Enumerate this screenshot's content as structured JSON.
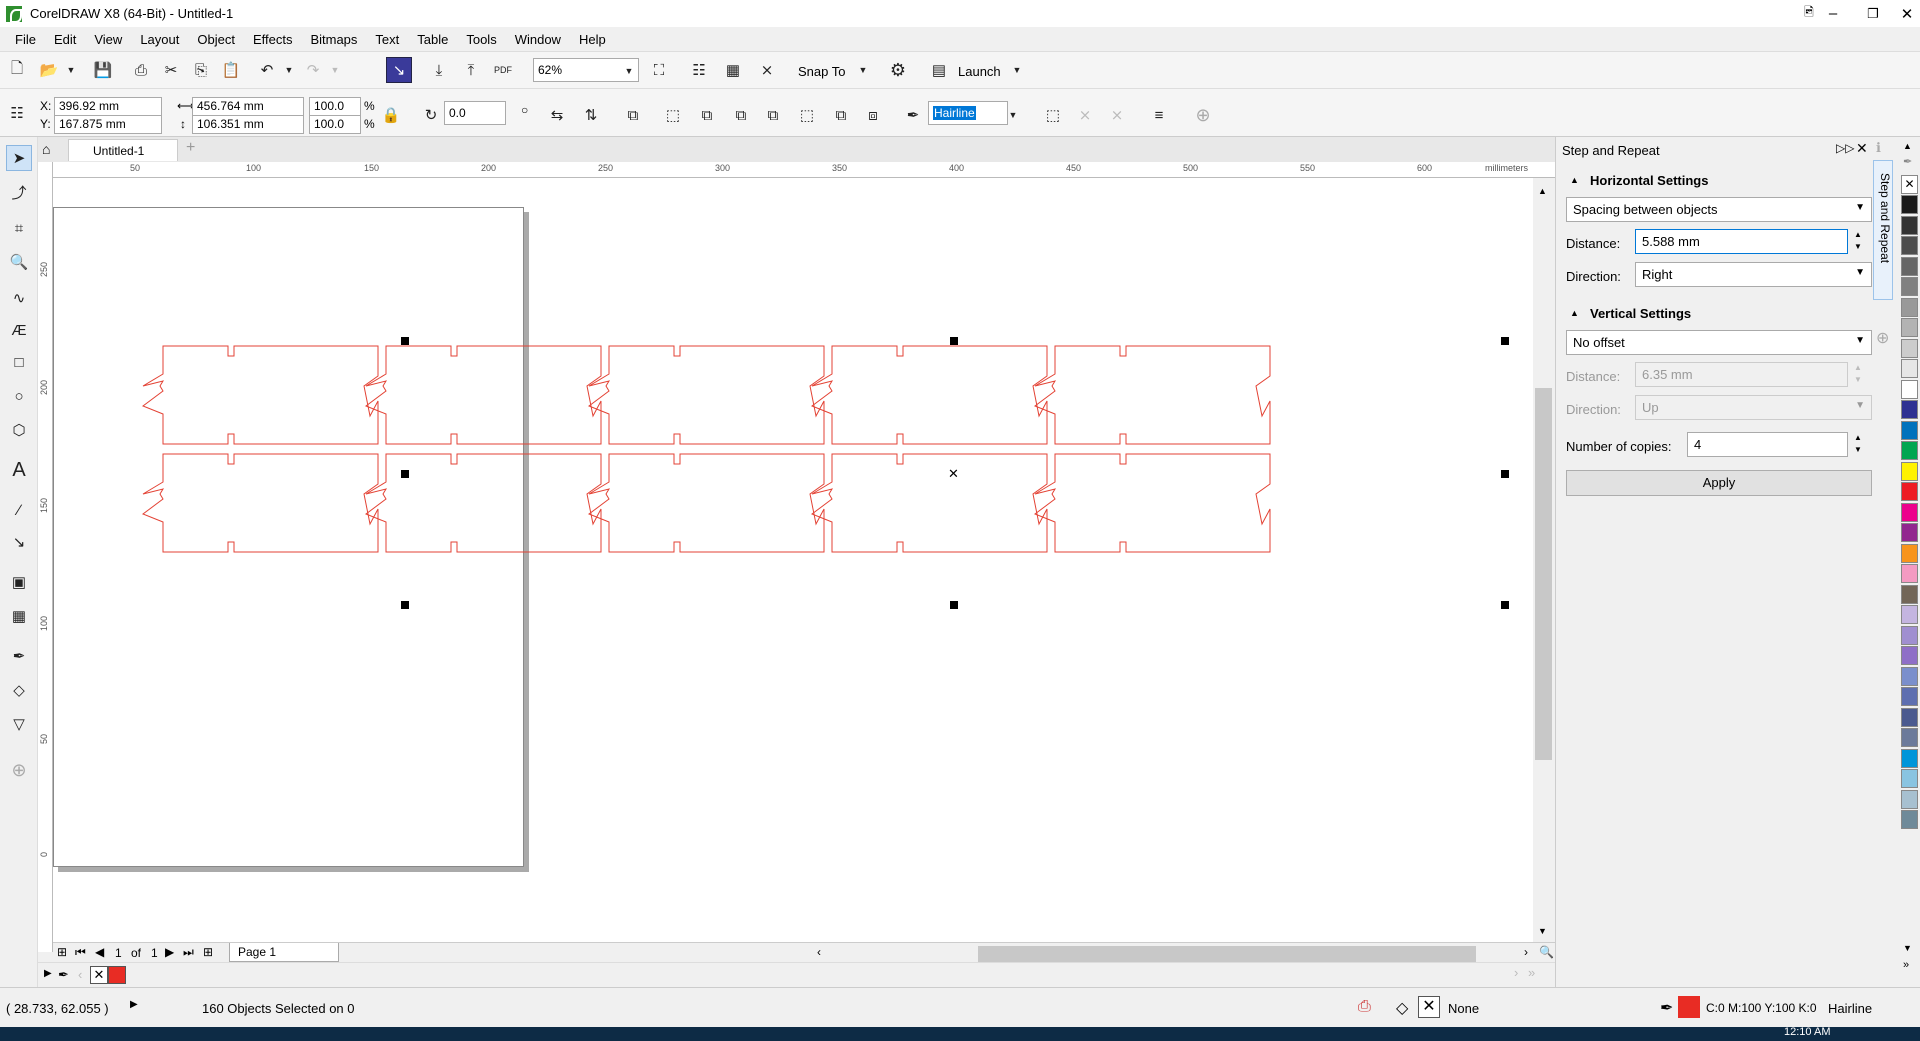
{
  "window": {
    "title": "CorelDRAW X8 (64-Bit) - Untitled-1"
  },
  "menu": [
    "File",
    "Edit",
    "View",
    "Layout",
    "Object",
    "Effects",
    "Bitmaps",
    "Text",
    "Table",
    "Tools",
    "Window",
    "Help"
  ],
  "toolbar": {
    "zoom_value": "62%",
    "snap_label": "Snap To",
    "launch_label": "Launch"
  },
  "properties": {
    "x_label": "X:",
    "x_value": "396.92 mm",
    "y_label": "Y:",
    "y_value": "167.875 mm",
    "width_value": "456.764 mm",
    "height_value": "106.351 mm",
    "scale_w": "100.0",
    "scale_h": "100.0",
    "percent": "%",
    "rotation": "0.0",
    "outline_width": "Hairline"
  },
  "document": {
    "tab_label": "Untitled-1",
    "ruler_units": "millimeters",
    "ruler_h_ticks": [
      "50",
      "100",
      "150",
      "200",
      "250",
      "300",
      "350",
      "400",
      "450",
      "500",
      "550",
      "600"
    ],
    "ruler_v_ticks": [
      "250",
      "200",
      "150",
      "100",
      "50",
      "0"
    ]
  },
  "page_nav": {
    "current": "1",
    "of_label": "of",
    "total": "1",
    "page_tab": "Page 1"
  },
  "docker": {
    "title": "Step and Repeat",
    "tab_label": "Step and Repeat",
    "horizontal_title": "Horizontal Settings",
    "h_mode": "Spacing between objects",
    "h_distance_label": "Distance:",
    "h_distance_value": "5.588 mm",
    "h_direction_label": "Direction:",
    "h_direction_value": "Right",
    "vertical_title": "Vertical Settings",
    "v_mode": "No offset",
    "v_distance_label": "Distance:",
    "v_distance_value": "6.35 mm",
    "v_direction_label": "Direction:",
    "v_direction_value": "Up",
    "copies_label": "Number of copies:",
    "copies_value": "4",
    "apply_label": "Apply"
  },
  "palette_colors": [
    "#1a1a1a",
    "#333333",
    "#4d4d4d",
    "#666666",
    "#808080",
    "#999999",
    "#b3b3b3",
    "#cccccc",
    "#e6e6e6",
    "#ffffff",
    "#2e3192",
    "#0072bc",
    "#00a651",
    "#fff200",
    "#ed1c24",
    "#ec008c",
    "#92278f",
    "#f7941d",
    "#f49ac2",
    "#726658",
    "#c4b5e0",
    "#a08fd0",
    "#8f6fc7",
    "#7b8fcc",
    "#5e6fb0",
    "#4b5a8f",
    "#6c7a9a",
    "#0095d9",
    "#89c4e1",
    "#a7c0d0",
    "#6f8a99"
  ],
  "status": {
    "coords": "( 28.733, 62.055 )",
    "selection": "160 Objects Selected on 0",
    "fill_label": "None",
    "outline_color": "C:0 M:100 Y:100 K:0",
    "outline_width": "Hairline"
  },
  "taskbar": {
    "clock": "12:10 AM"
  }
}
